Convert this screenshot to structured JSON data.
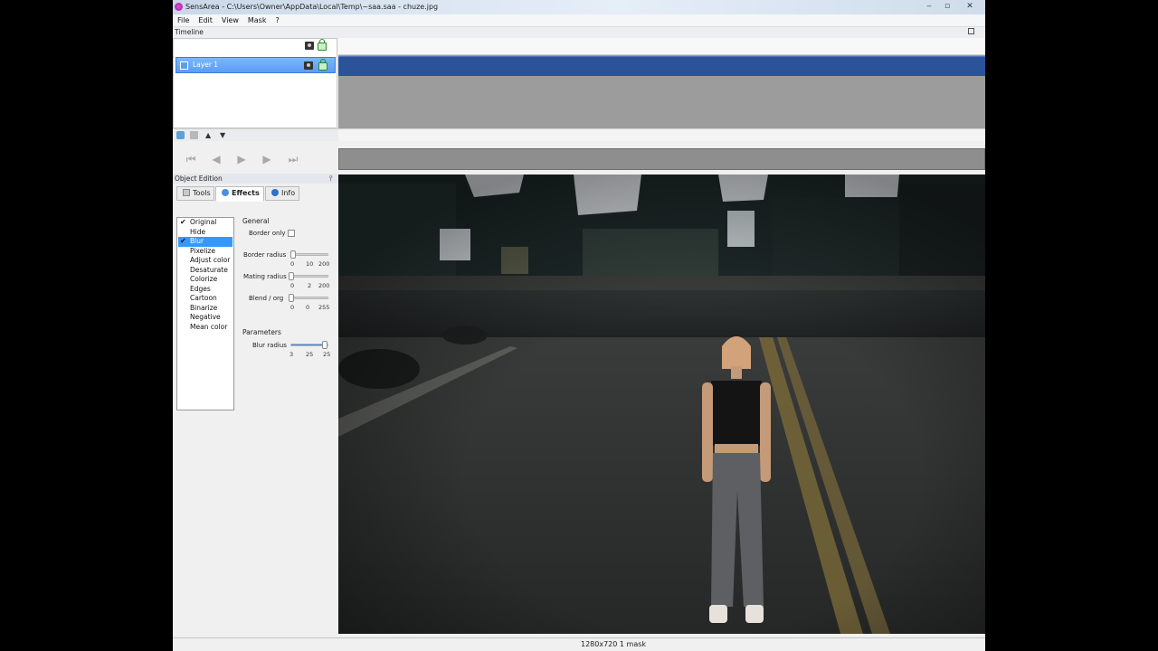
{
  "window": {
    "title": "SensArea - C:\\Users\\Owner\\AppData\\Local\\Temp\\~saa.saa - chuze.jpg",
    "controls": {
      "minimize": "‒",
      "maximize": "▫",
      "close": "✕"
    }
  },
  "menu": [
    "File",
    "Edit",
    "View",
    "Mask",
    "?"
  ],
  "timeline": {
    "header": "Timeline",
    "layer_name": "Layer 1"
  },
  "layer_tools": {
    "up": "▲",
    "down": "▼"
  },
  "transport": {
    "first": "⏮",
    "prev": "◀",
    "play": "▶",
    "next": "▶",
    "last": "⏭"
  },
  "object_edition": {
    "header": "Object Edition",
    "pin": "📌",
    "tabs": [
      "Tools",
      "Effects",
      "Info"
    ],
    "active_tab": "Effects",
    "effects": [
      {
        "label": "Original",
        "checked": true
      },
      {
        "label": "Hide",
        "checked": false
      },
      {
        "label": "Blur",
        "checked": true,
        "selected": true
      },
      {
        "label": "Pixelize",
        "checked": false
      },
      {
        "label": "Adjust color",
        "checked": false
      },
      {
        "label": "Desaturate",
        "checked": false
      },
      {
        "label": "Colorize",
        "checked": false
      },
      {
        "label": "Edges",
        "checked": false
      },
      {
        "label": "Cartoon",
        "checked": false
      },
      {
        "label": "Binarize",
        "checked": false
      },
      {
        "label": "Negative",
        "checked": false
      },
      {
        "label": "Mean color",
        "checked": false
      }
    ],
    "general": {
      "title": "General",
      "border_only_label": "Border only",
      "border_radius": {
        "label": "Border radius",
        "min": "0",
        "value": "10",
        "max": "200"
      },
      "mating_radius": {
        "label": "Mating radius",
        "min": "0",
        "value": "2",
        "max": "200"
      },
      "blend_org": {
        "label": "Blend / org",
        "min": "0",
        "value": "0",
        "max": "255"
      }
    },
    "parameters": {
      "title": "Parameters",
      "blur_radius": {
        "label": "Blur radius",
        "min": "3",
        "value": "25",
        "max": "25"
      }
    }
  },
  "status": {
    "text": "1280x720  1 mask"
  }
}
